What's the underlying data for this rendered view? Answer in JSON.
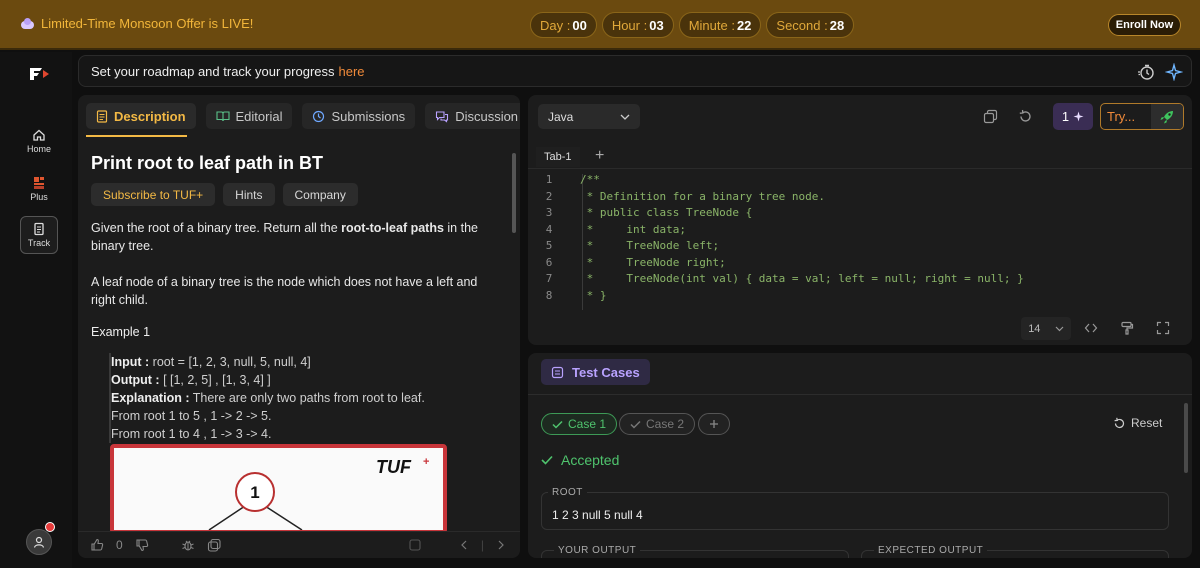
{
  "banner": {
    "offer_text": "Limited-Time Monsoon Offer is LIVE!",
    "timer": [
      {
        "label": "Day :",
        "value": "00"
      },
      {
        "label": "Hour :",
        "value": "03"
      },
      {
        "label": "Minute :",
        "value": "22"
      },
      {
        "label": "Second :",
        "value": "28"
      }
    ],
    "enroll_label": "Enroll Now"
  },
  "rail": {
    "items": [
      {
        "label": "Home",
        "icon": "home-icon"
      },
      {
        "label": "Plus",
        "icon": "plus-logo-icon"
      },
      {
        "label": "Track",
        "icon": "track-icon"
      }
    ]
  },
  "roadmap": {
    "text": "Set your roadmap and track your progress",
    "link": "here"
  },
  "problem": {
    "tabs": [
      "Description",
      "Editorial",
      "Submissions",
      "Discussion"
    ],
    "title": "Print root to leaf path in BT",
    "tags": [
      "Subscribe to TUF+",
      "Hints",
      "Company"
    ],
    "desc1_prefix": "Given the root of a binary tree. Return all the ",
    "desc1_bold": "root-to-leaf paths",
    "desc1_suffix": " in the binary tree.",
    "desc2": "A leaf node of a binary tree is the node which does not have a left and right child.",
    "example_title": "Example 1",
    "example": {
      "input_label": "Input :",
      "input_value": " root = [1, 2, 3, null, 5, null, 4]",
      "output_label": "Output :",
      "output_value": " [ [1, 2, 5] , [1, 3, 4] ]",
      "explanation_label": "Explanation :",
      "explanation_value": " There are only two paths from root to leaf.",
      "line4": "From root 1 to 5 , 1 -> 2 -> 5.",
      "line5": "From root 1 to 4 , 1 -> 3 -> 4."
    },
    "image_brand": "TUF",
    "image_node": "1",
    "likes": "0"
  },
  "editor": {
    "language": "Java",
    "count": "1",
    "try_label": "Try...",
    "tab_label": "Tab-1",
    "font_size": "14",
    "lines": [
      {
        "n": "1",
        "code": "/**"
      },
      {
        "n": "2",
        "code": " * Definition for a binary tree node."
      },
      {
        "n": "3",
        "code": " * public class TreeNode {"
      },
      {
        "n": "4",
        "code": " *     int data;"
      },
      {
        "n": "5",
        "code": " *     TreeNode left;"
      },
      {
        "n": "6",
        "code": " *     TreeNode right;"
      },
      {
        "n": "7",
        "code": " *     TreeNode(int val) { data = val; left = null; right = null; }"
      },
      {
        "n": "8",
        "code": " * }"
      }
    ]
  },
  "tests": {
    "title": "Test Cases",
    "cases": [
      "Case 1",
      "Case 2"
    ],
    "reset_label": "Reset",
    "status": "Accepted",
    "root_label": "ROOT",
    "root_value": "1 2 3 null 5 null 4",
    "your_output_label": "YOUR OUTPUT",
    "expected_output_label": "EXPECTED OUTPUT"
  },
  "colors": {
    "accent": "#f3b945",
    "link": "#f08a3a",
    "success": "#4fc36d",
    "purple": "#b9a2ff"
  }
}
